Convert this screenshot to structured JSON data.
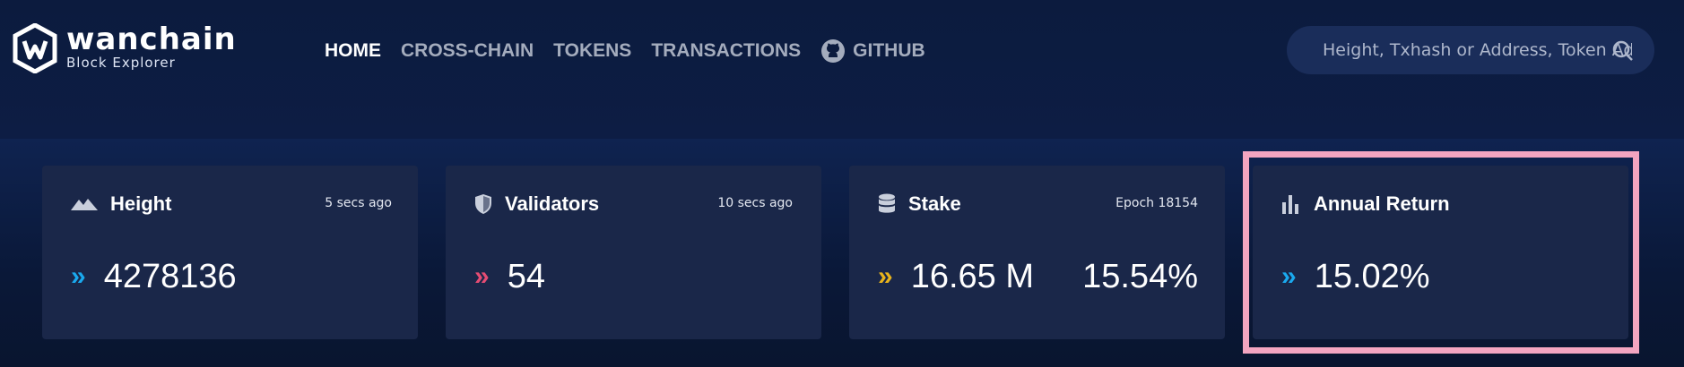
{
  "brand": {
    "name": "wanchain",
    "subtitle": "Block Explorer"
  },
  "nav": {
    "items": [
      {
        "label": "HOME",
        "active": true
      },
      {
        "label": "CROSS-CHAIN",
        "active": false
      },
      {
        "label": "TOKENS",
        "active": false
      },
      {
        "label": "TRANSACTIONS",
        "active": false
      },
      {
        "label": "GITHUB",
        "active": false,
        "icon": "github-icon"
      }
    ]
  },
  "search": {
    "placeholder": "Height, Txhash or Address, Token Address",
    "icon": "search-icon"
  },
  "colors": {
    "chevron_blue": "#1aa9ee",
    "chevron_pink": "#e54c73",
    "chevron_yellow": "#e8b31c",
    "highlight": "#f3a5c0"
  },
  "cards": {
    "height": {
      "title": "Height",
      "meta": "5 secs ago",
      "value": "4278136",
      "icon": "mountain-icon"
    },
    "validators": {
      "title": "Validators",
      "meta": "10 secs ago",
      "value": "54",
      "icon": "shield-icon"
    },
    "stake": {
      "title": "Stake",
      "meta": "Epoch 18154",
      "value": "16.65 M",
      "value2": "15.54%",
      "icon": "database-icon"
    },
    "annual_return": {
      "title": "Annual Return",
      "value": "15.02%",
      "icon": "bar-chart-icon"
    }
  }
}
